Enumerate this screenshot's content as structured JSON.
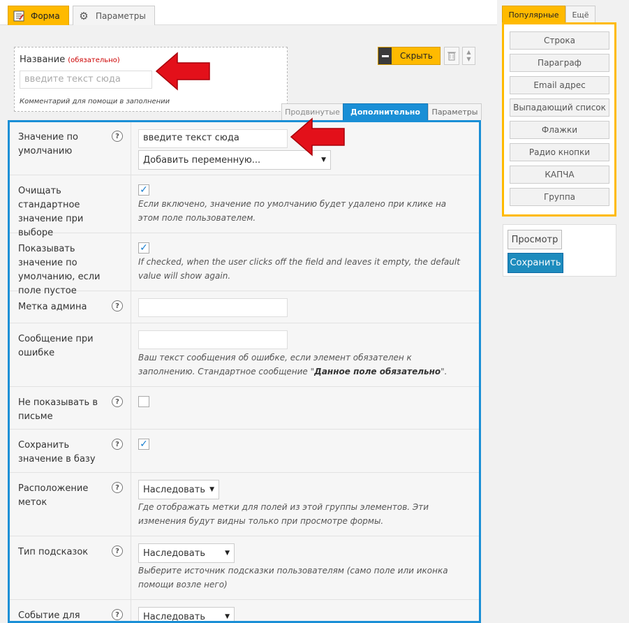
{
  "top_tabs": {
    "form_label": "Форма",
    "params_label": "Параметры"
  },
  "title_field": {
    "label": "Название",
    "required": "(обязательно)",
    "placeholder": "введите текст сюда",
    "comment": "Комментарий для помощи в заполнении"
  },
  "controls": {
    "hide_label": "Скрыть"
  },
  "sub_tabs": [
    "Продвинутые",
    "Дополнительно",
    "Параметры"
  ],
  "settings": {
    "default_value": {
      "label": "Значение по умолчанию",
      "input_value": "введите текст сюда",
      "variable_select": "Добавить переменную..."
    },
    "clear_default": {
      "label": "Очищать стандартное значение при выборе",
      "checked": true,
      "description": "Если включено, значение по умолчанию будет удалено при клике на этом поле пользователем."
    },
    "show_default": {
      "label": "Показывать значение по умолчанию, если поле пустое",
      "checked": true,
      "description": "If checked, when the user clicks off the field and leaves it empty, the default value will show again."
    },
    "admin_label": {
      "label": "Метка админа",
      "value": ""
    },
    "error_message": {
      "label": "Сообщение при ошибке",
      "value": "",
      "description_1": "Ваш текст сообщения об ошибке, если элемент обязателен к заполнению. Стандартное сообщение \"",
      "description_bold": "Данное поле обязательно",
      "description_2": "\"."
    },
    "hide_in_email": {
      "label": "Не показывать в письме",
      "checked": false
    },
    "save_to_db": {
      "label": "Сохранить значение в базу",
      "checked": true
    },
    "label_position": {
      "label": "Расположение меток",
      "selected": "Наследовать",
      "description": "Где отображать метки для полей из этой группы элементов. Эти изменения будут видны только при просмотре формы."
    },
    "tooltip_type": {
      "label": "Тип подсказок",
      "selected": "Наследовать",
      "description": "Выберите источник подсказки пользователям (само поле или иконка помощи возле него)"
    },
    "event_for": {
      "label": "Событие для",
      "selected": "Наследовать"
    }
  },
  "sidebar": {
    "tab_popular": "Популярные",
    "tab_more": "Ещё",
    "fields": [
      "Строка",
      "Параграф",
      "Email адрес",
      "Выпадающий список",
      "Флажки",
      "Радио кнопки",
      "КАПЧА",
      "Группа"
    ],
    "preview_label": "Просмотр",
    "save_label": "Сохранить"
  },
  "colors": {
    "accent_yellow": "#ffba00",
    "accent_blue": "#1a8fd6",
    "arrow_red": "#e3101a"
  },
  "icons": {
    "form_tab": "form-icon",
    "params_tab": "gear-icon",
    "help": "help-icon",
    "trash": "trash-icon",
    "sort": "sort-arrows-icon"
  }
}
